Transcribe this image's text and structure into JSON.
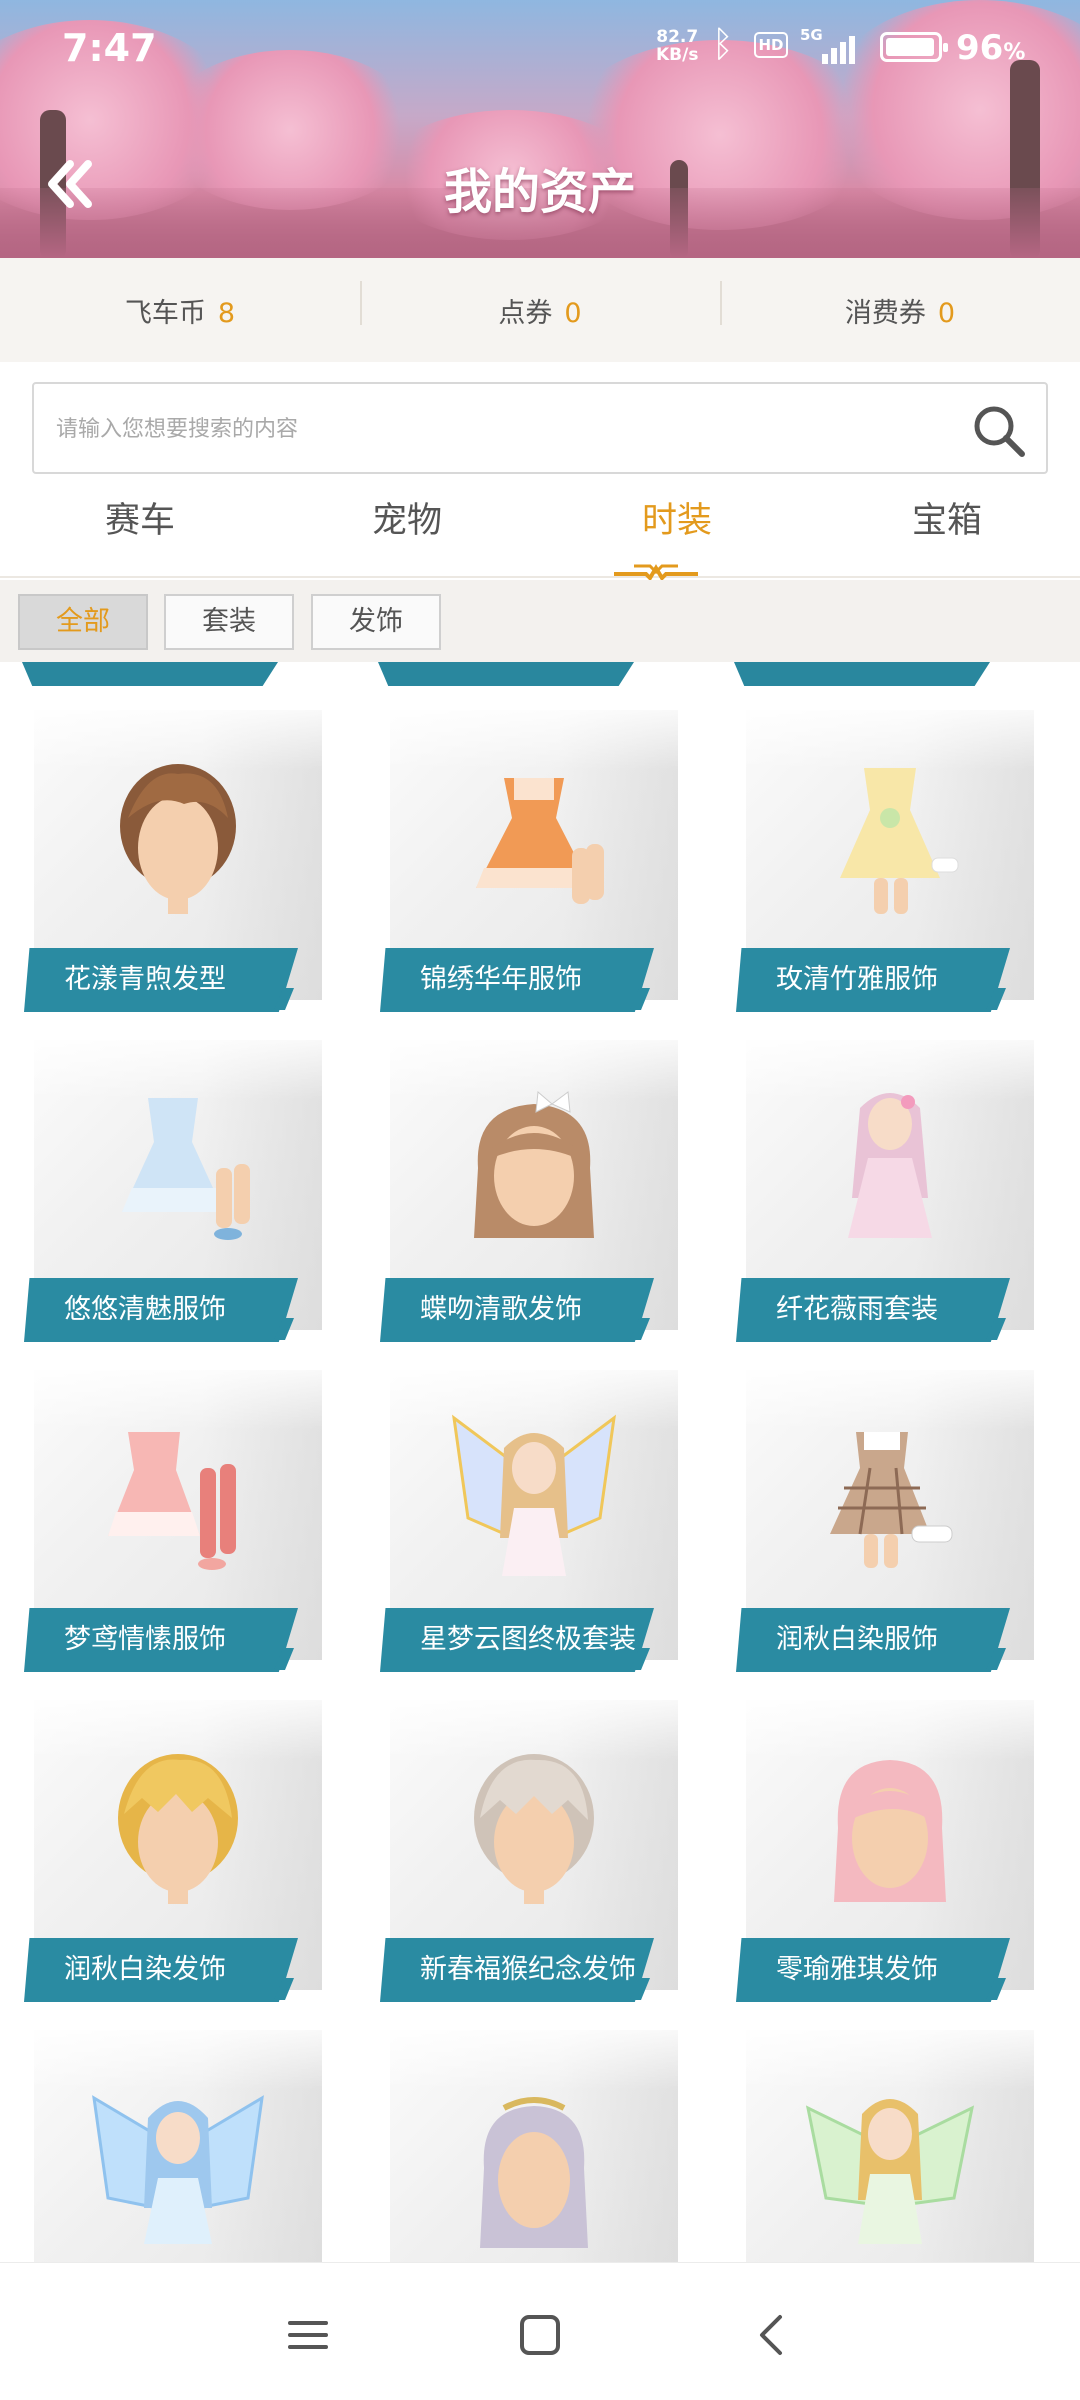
{
  "status_bar": {
    "time": "7:47",
    "net_speed_top": "82.7",
    "net_speed_bottom": "KB/s",
    "hd": "HD",
    "signal": "5G",
    "battery_percent": "96",
    "battery_unit": "%",
    "battery_level": 0.96
  },
  "header": {
    "title": "我的资产",
    "back_icon": "double-chevron-left-icon"
  },
  "currencies": [
    {
      "label": "飞车币",
      "value": "8"
    },
    {
      "label": "点券",
      "value": "0"
    },
    {
      "label": "消费券",
      "value": "0"
    }
  ],
  "search": {
    "placeholder": "请输入您想要搜索的内容",
    "icon": "search-icon"
  },
  "tabs": [
    {
      "label": "赛车",
      "active": false
    },
    {
      "label": "宠物",
      "active": false
    },
    {
      "label": "时装",
      "active": true
    },
    {
      "label": "宝箱",
      "active": false
    }
  ],
  "filters": [
    {
      "label": "全部",
      "active": true
    },
    {
      "label": "套装",
      "active": false
    },
    {
      "label": "发饰",
      "active": false
    }
  ],
  "items": [
    {
      "name": "花漾青煦发型",
      "icon": "hair-brown-short-icon"
    },
    {
      "name": "锦绣华年服饰",
      "icon": "dress-orange-icon"
    },
    {
      "name": "玫清竹雅服饰",
      "icon": "dress-yellow-icon"
    },
    {
      "name": "悠悠清魅服饰",
      "icon": "dress-blue-icon"
    },
    {
      "name": "蝶吻清歌发饰",
      "icon": "hair-brown-long-bow-icon"
    },
    {
      "name": "纤花薇雨套装",
      "icon": "character-pink-dress-icon"
    },
    {
      "name": "梦鸢情愫服饰",
      "icon": "dress-pink-stockings-icon"
    },
    {
      "name": "星梦云图终极套装",
      "icon": "character-winged-icon"
    },
    {
      "name": "润秋白染服饰",
      "icon": "dress-plaid-icon"
    },
    {
      "name": "润秋白染发饰",
      "icon": "hair-blonde-short-icon"
    },
    {
      "name": "新春福猴纪念发饰",
      "icon": "hair-silver-short-icon"
    },
    {
      "name": "零瑜雅琪发饰",
      "icon": "hair-pink-long-icon"
    },
    {
      "name": "",
      "icon": "character-blue-winged-icon"
    },
    {
      "name": "",
      "icon": "hair-silver-long-icon"
    },
    {
      "name": "",
      "icon": "character-green-winged-icon"
    }
  ],
  "nav": {
    "menu_icon": "menu-icon",
    "home_icon": "home-square-icon",
    "back_icon": "back-chevron-icon"
  },
  "colors": {
    "accent": "#e39a1d",
    "label_bg": "#2a8ba2"
  }
}
